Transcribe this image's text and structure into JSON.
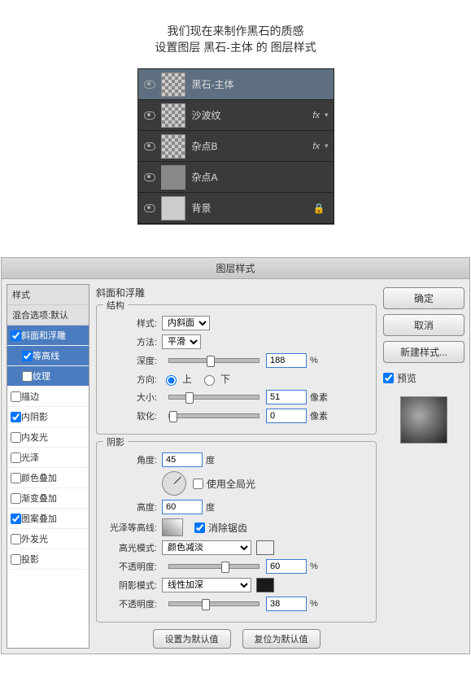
{
  "intro": {
    "l1": "我们现在来制作黑石的质感",
    "l2": "设置图层 黑石-主体 的 图层样式"
  },
  "layers": [
    {
      "name": "黑石-主体",
      "sel": true,
      "thumb": "checker"
    },
    {
      "name": "沙波纹",
      "fx": true,
      "thumb": "checker"
    },
    {
      "name": "杂点B",
      "fx": true,
      "thumb": "checker"
    },
    {
      "name": "杂点A",
      "thumb": "noise"
    },
    {
      "name": "背景",
      "lock": true,
      "thumb": "solid"
    }
  ],
  "dialog": {
    "title": "图层样式",
    "styles_header": "样式",
    "blend_header": "混合选项:默认",
    "effects": [
      {
        "label": "斜面和浮雕",
        "checked": true,
        "active": true
      },
      {
        "label": "等高线",
        "checked": true,
        "sub": true,
        "active": true
      },
      {
        "label": "纹理",
        "checked": false,
        "sub": true,
        "active": true
      },
      {
        "label": "描边",
        "checked": false
      },
      {
        "label": "内阴影",
        "checked": true
      },
      {
        "label": "内发光",
        "checked": false
      },
      {
        "label": "光泽",
        "checked": false
      },
      {
        "label": "颜色叠加",
        "checked": false
      },
      {
        "label": "渐变叠加",
        "checked": false
      },
      {
        "label": "图案叠加",
        "checked": true
      },
      {
        "label": "外发光",
        "checked": false
      },
      {
        "label": "投影",
        "checked": false
      }
    ],
    "section_title": "斜面和浮雕",
    "structure": {
      "legend": "结构",
      "style_label": "样式:",
      "style_val": "内斜面",
      "technique_label": "方法:",
      "technique_val": "平滑",
      "depth_label": "深度:",
      "depth_val": "188",
      "depth_unit": "%",
      "direction_label": "方向:",
      "up": "上",
      "down": "下",
      "size_label": "大小:",
      "size_val": "51",
      "size_unit": "像素",
      "soften_label": "软化:",
      "soften_val": "0",
      "soften_unit": "像素"
    },
    "shading": {
      "legend": "阴影",
      "angle_label": "角度:",
      "angle_val": "45",
      "angle_unit": "度",
      "global": "使用全局光",
      "altitude_label": "高度:",
      "altitude_val": "60",
      "altitude_unit": "度",
      "gloss_label": "光泽等高线:",
      "antialias": "消除锯齿",
      "hmode_label": "高光模式:",
      "hmode_val": "颜色减淡",
      "hop_label": "不透明度:",
      "hop_val": "60",
      "hop_unit": "%",
      "smode_label": "阴影模式:",
      "smode_val": "线性加深",
      "sop_label": "不透明度:",
      "sop_val": "38",
      "sop_unit": "%"
    },
    "set_default": "设置为默认值",
    "reset_default": "复位为默认值",
    "ok": "确定",
    "cancel": "取消",
    "new_style": "新建样式...",
    "preview": "预览"
  }
}
